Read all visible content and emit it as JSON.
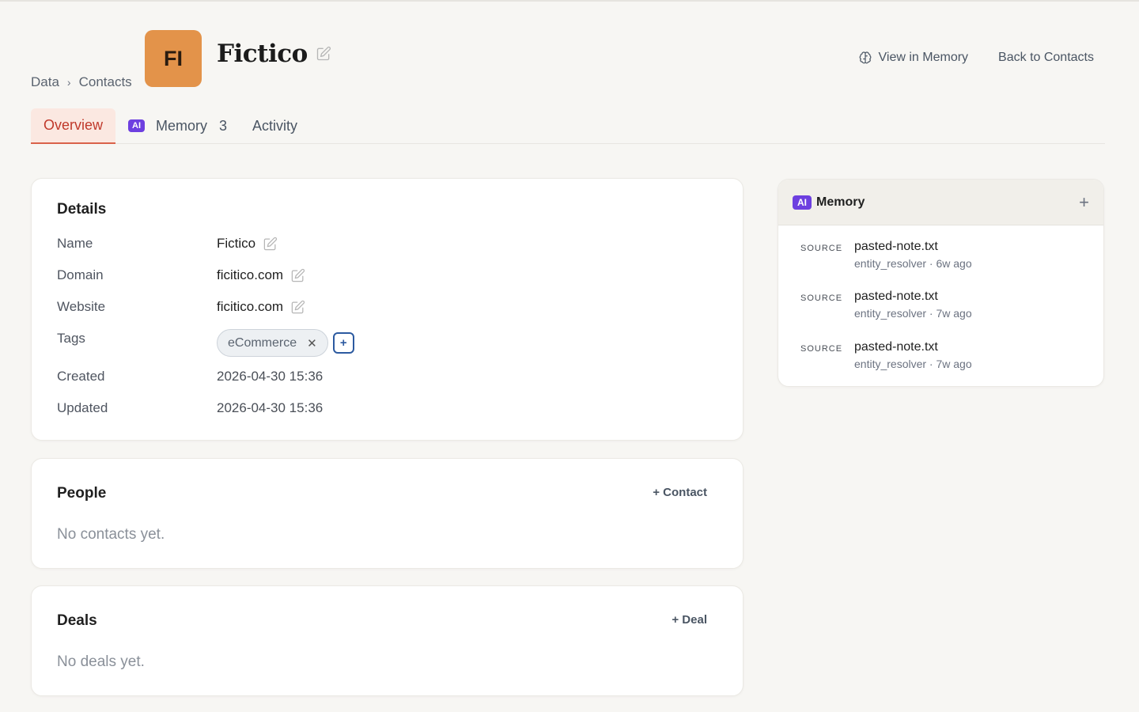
{
  "breadcrumb": {
    "root": "Data",
    "separator": "›",
    "current": "Contacts"
  },
  "avatar": {
    "initials": "FI",
    "color": "#e3934a"
  },
  "page": {
    "title": "Fictico"
  },
  "header": {
    "view_memory": "View in Memory",
    "back": "Back to Contacts"
  },
  "tabs": [
    {
      "label": "Overview",
      "active": true
    },
    {
      "badge": "AI",
      "label": "Memory",
      "count": "3"
    },
    {
      "label": "Activity"
    }
  ],
  "details": {
    "title": "Details",
    "fields": [
      {
        "label": "Name",
        "value": "Fictico"
      },
      {
        "label": "Domain",
        "value": "ficitico.com"
      },
      {
        "label": "Website",
        "value": "ficitico.com"
      },
      {
        "label": "Tags",
        "tag": "eCommerce",
        "remove": "✕",
        "add": "+"
      },
      {
        "label": "Created",
        "value": "2026-04-30 15:36"
      },
      {
        "label": "Updated",
        "value": "2026-04-30 15:36"
      }
    ]
  },
  "people": {
    "title": "People",
    "action": "+ Contact",
    "empty": "No contacts yet."
  },
  "deals": {
    "title": "Deals",
    "action": "+ Deal",
    "empty": "No deals yet."
  },
  "memory": {
    "badge": "AI",
    "title": "Memory",
    "add": "+",
    "items": [
      {
        "source": "SOURCE",
        "file": "pasted-note.txt",
        "meta": "entity_resolver · 6w ago"
      },
      {
        "source": "SOURCE",
        "file": "pasted-note.txt",
        "meta": "entity_resolver · 7w ago"
      },
      {
        "source": "SOURCE",
        "file": "pasted-note.txt",
        "meta": "entity_resolver · 7w ago"
      }
    ]
  },
  "colors": {
    "accent": "#c0392b",
    "ai_badge": "#6d3fe0",
    "avatar": "#e3934a",
    "tag_add": "#2c5aa0"
  },
  "icons": {
    "edit": "pencil-square-icon",
    "memory": "brain-icon",
    "remove_tag": "close-icon",
    "add": "plus-icon"
  }
}
